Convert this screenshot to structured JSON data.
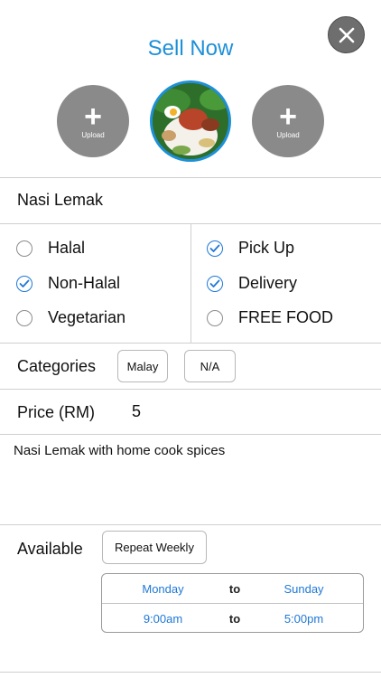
{
  "header": {
    "title": "Sell Now",
    "close_icon": "close-icon"
  },
  "photos": {
    "upload_left_label": "Upload",
    "upload_right_label": "Upload",
    "plus_glyph": "+",
    "main_photo_icon": "food-photo"
  },
  "dish": {
    "name": "Nasi Lemak"
  },
  "diet_options": [
    {
      "label": "Halal",
      "checked": false
    },
    {
      "label": "Non-Halal",
      "checked": true
    },
    {
      "label": "Vegetarian",
      "checked": false
    }
  ],
  "service_options": [
    {
      "label": "Pick Up",
      "checked": true
    },
    {
      "label": "Delivery",
      "checked": true
    },
    {
      "label": "FREE FOOD",
      "checked": false
    }
  ],
  "categories": {
    "label": "Categories",
    "chips": [
      "Malay",
      "N/A"
    ]
  },
  "price": {
    "label": "Price (RM)",
    "value": "5"
  },
  "description": {
    "text": "Nasi Lemak with home cook spices"
  },
  "availability": {
    "label": "Available",
    "repeat_button": "Repeat Weekly",
    "from_day": "Monday",
    "to_day": "Sunday",
    "from_time": "9:00am",
    "to_time": "5:00pm",
    "to_label": "to"
  },
  "colors": {
    "accent": "#1e90d8",
    "check": "#1e78d6",
    "upload_bg": "#8a8a8a",
    "close_bg": "#6e6e6e"
  }
}
